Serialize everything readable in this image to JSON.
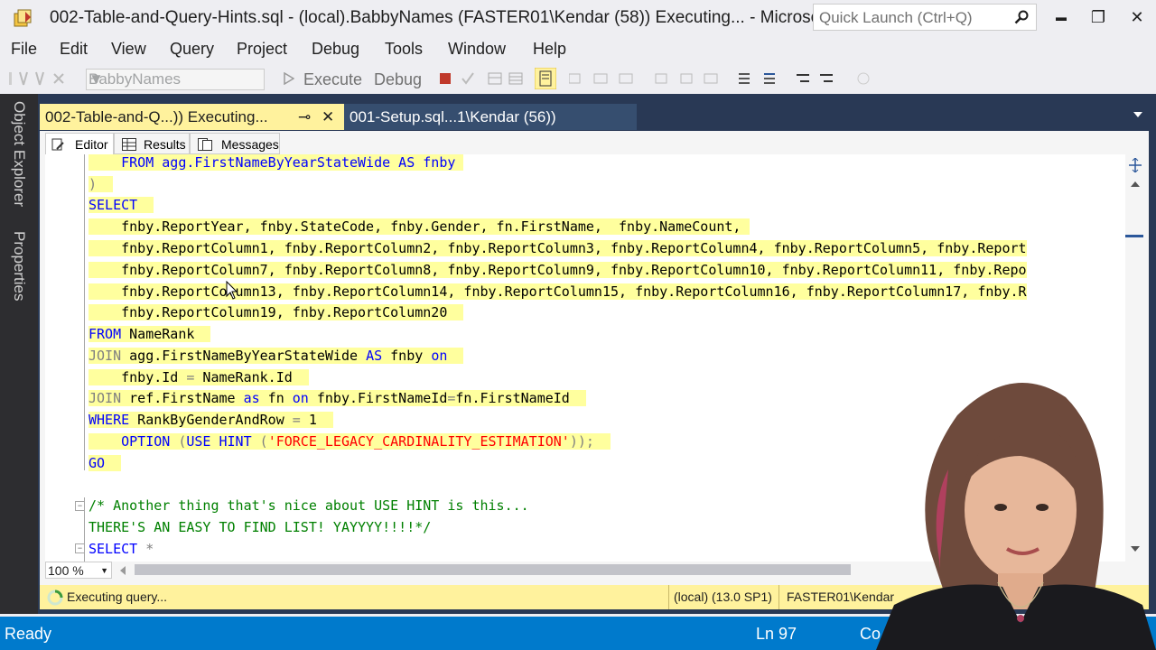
{
  "window": {
    "title": "002-Table-and-Query-Hints.sql - (local).BabbyNames (FASTER01\\Kendar (58)) Executing... - Microso...",
    "quick_launch_placeholder": "Quick Launch (Ctrl+Q)",
    "min": "▬",
    "max": "❐",
    "close": "✕"
  },
  "menu": [
    "File",
    "Edit",
    "View",
    "Query",
    "Project",
    "Debug",
    "Tools",
    "Window",
    "Help"
  ],
  "toolbar": {
    "database": "BabbyNames",
    "execute": "Execute",
    "debug": "Debug"
  },
  "dock": {
    "object_explorer": "Object Explorer",
    "properties": "Properties"
  },
  "tabs": [
    {
      "label": "002-Table-and-Q...)) Executing...",
      "pin": "⊸",
      "close": "✕"
    },
    {
      "label": "001-Setup.sql...1\\Kendar (56))"
    }
  ],
  "subtabs": [
    "Editor",
    "Results",
    "Messages"
  ],
  "zoom": "100 %",
  "query_status": {
    "text": "Executing query...",
    "server": "(local) (13.0 SP1)",
    "user": "FASTER01\\Kendar"
  },
  "status": {
    "ready": "Ready",
    "line": "Ln 97",
    "col": "Co"
  },
  "code": {
    "l1": "FROM agg.FirstNameByYearStateWide AS fnby",
    "l2": ")",
    "l3": "SELECT",
    "l4": "fnby.ReportYear, fnby.StateCode, fnby.Gender, fn.FirstName,  fnby.NameCount,",
    "l5": "fnby.ReportColumn1, fnby.ReportColumn2, fnby.ReportColumn3, fnby.ReportColumn4, fnby.ReportColumn5, fnby.Report",
    "l6": "fnby.ReportColumn7, fnby.ReportColumn8, fnby.ReportColumn9, fnby.ReportColumn10, fnby.ReportColumn11, fnby.Repo",
    "l7": "fnby.ReportColumn13, fnby.ReportColumn14, fnby.ReportColumn15, fnby.ReportColumn16, fnby.ReportColumn17, fnby.R",
    "l8": "fnby.ReportColumn19, fnby.ReportColumn20",
    "l9a": "FROM",
    "l9b": " NameRank",
    "l10a": "JOIN",
    "l10b": " agg.FirstNameByYearStateWide ",
    "l10c": "AS",
    "l10d": " fnby ",
    "l10e": "on",
    "l11a": "fnby.Id ",
    "l11b": "=",
    "l11c": " NameRank.Id",
    "l12a": "JOIN",
    "l12b": " ref.FirstName ",
    "l12c": "as",
    "l12d": " fn ",
    "l12e": "on",
    "l12f": " fnby.FirstNameId",
    "l12g": "=",
    "l12h": "fn.FirstNameId",
    "l13a": "WHERE",
    "l13b": " RankByGenderAndRow ",
    "l13c": "=",
    "l13d": " 1",
    "l14a": "OPTION",
    "l14b": " (",
    "l14c": "USE HINT",
    "l14d": " (",
    "l14e": "'FORCE_LEGACY_CARDINALITY_ESTIMATION'",
    "l14f": "));",
    "l15": "GO",
    "l16": "/* Another thing that's nice about USE HINT is this...",
    "l17": "THERE'S AN EASY TO FIND LIST! YAYYYY!!!!*/",
    "l18a": "SELECT",
    "l18b": " *"
  }
}
